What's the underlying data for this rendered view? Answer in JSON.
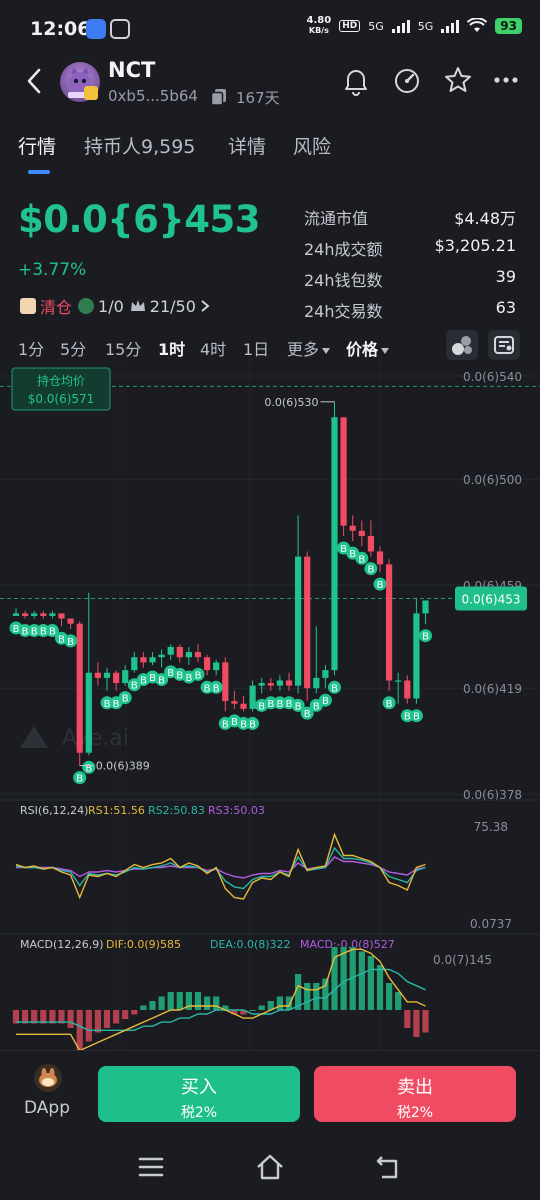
{
  "status_bar": {
    "time": "12:06",
    "net_speed_value": "4.80",
    "net_speed_unit": "KB/s",
    "hd_label": "HD",
    "signal_1": "5G",
    "signal_2": "5G",
    "battery": "93"
  },
  "header": {
    "token_name": "NCT",
    "address": "0xb5...5b64",
    "age": "167天"
  },
  "tabs": [
    {
      "label": "行情"
    },
    {
      "label": "持币人9,595"
    },
    {
      "label": "详情"
    },
    {
      "label": "风险"
    }
  ],
  "price": {
    "value": "$0.0{6}453",
    "change": "+3.77%"
  },
  "tags": {
    "clear": "清仓",
    "ratio": "1/0",
    "rank": "21/50"
  },
  "stats": [
    {
      "label": "流通市值",
      "value": "$4.48万"
    },
    {
      "label": "24h成交额",
      "value": "$3,205.21"
    },
    {
      "label": "24h钱包数",
      "value": "39"
    },
    {
      "label": "24h交易数",
      "value": "63"
    }
  ],
  "intervals": [
    {
      "label": "1分"
    },
    {
      "label": "5分"
    },
    {
      "label": "15分"
    },
    {
      "label": "1时"
    },
    {
      "label": "4时"
    },
    {
      "label": "1日"
    },
    {
      "label": "更多"
    },
    {
      "label": "价格"
    }
  ],
  "colors": {
    "up": "#20c38e",
    "down": "#ef4b62",
    "accent": "#3d8bfd",
    "rsi1": "#e7b93a",
    "rsi2": "#28b6a8",
    "rsi3": "#b35be0"
  },
  "chart_data": {
    "type": "candlestick",
    "watermark": "Ave.ai",
    "position_avg_label": "持仓均价",
    "position_avg_value": "$0.0(6)571",
    "current_price_tag": "0.0(6)453",
    "y_axis_ticks": [
      "0.0(6)540",
      "0.0(6)500",
      "0.0(6)459",
      "0.0(6)419",
      "0.0(6)378"
    ],
    "y_axis_values": [
      540,
      500,
      459,
      419,
      378
    ],
    "high_label": "0.0(6)530",
    "low_label": "0.0(6)389",
    "trade_marker_label": "B",
    "candles": [
      [
        447,
        450,
        447,
        448
      ],
      [
        448,
        449,
        446,
        447
      ],
      [
        447,
        449,
        446,
        448
      ],
      [
        448,
        449,
        446,
        447
      ],
      [
        447,
        449,
        446,
        448
      ],
      [
        448,
        448,
        443,
        446
      ],
      [
        446,
        446,
        442,
        444
      ],
      [
        444,
        445,
        389,
        394
      ],
      [
        394,
        456,
        393,
        425
      ],
      [
        425,
        429,
        420,
        423
      ],
      [
        423,
        427,
        418,
        425
      ],
      [
        425,
        426,
        418,
        421
      ],
      [
        421,
        428,
        420,
        426
      ],
      [
        426,
        433,
        425,
        431
      ],
      [
        431,
        433,
        427,
        429
      ],
      [
        429,
        433,
        428,
        431
      ],
      [
        431,
        434,
        427,
        432
      ],
      [
        432,
        436,
        430,
        435
      ],
      [
        435,
        436,
        429,
        431
      ],
      [
        431,
        435,
        428,
        433
      ],
      [
        433,
        436,
        429,
        431
      ],
      [
        431,
        432,
        424,
        426
      ],
      [
        426,
        430,
        424,
        429
      ],
      [
        429,
        431,
        410,
        414
      ],
      [
        414,
        418,
        411,
        413
      ],
      [
        413,
        416,
        410,
        411
      ],
      [
        411,
        422,
        410,
        420
      ],
      [
        420,
        423,
        417,
        421
      ],
      [
        421,
        423,
        418,
        420
      ],
      [
        420,
        424,
        418,
        422
      ],
      [
        422,
        425,
        418,
        420
      ],
      [
        420,
        486,
        417,
        470
      ],
      [
        470,
        472,
        414,
        419
      ],
      [
        419,
        443,
        417,
        423
      ],
      [
        423,
        428,
        419,
        426
      ],
      [
        426,
        530,
        424,
        524
      ],
      [
        524,
        524,
        478,
        482
      ],
      [
        482,
        486,
        476,
        480
      ],
      [
        480,
        484,
        474,
        478
      ],
      [
        478,
        484,
        470,
        472
      ],
      [
        472,
        474,
        464,
        467
      ],
      [
        467,
        469,
        418,
        422
      ],
      [
        422,
        425,
        413,
        422
      ],
      [
        422,
        424,
        413,
        415
      ],
      [
        415,
        454,
        413,
        448
      ],
      [
        448,
        453,
        444,
        453
      ]
    ],
    "buy_markers": [
      0,
      1,
      2,
      3,
      4,
      5,
      6,
      7,
      8,
      10,
      11,
      12,
      13,
      14,
      15,
      16,
      17,
      18,
      19,
      20,
      21,
      22,
      23,
      24,
      25,
      26,
      27,
      28,
      29,
      30,
      31,
      32,
      33,
      34,
      35,
      36,
      37,
      38,
      39,
      40,
      41,
      43,
      44,
      45
    ],
    "rsi": {
      "label": "RSI(6,12,24)",
      "rs1": "RS1:51.56",
      "rs2": "RS2:50.83",
      "rs3": "RS3:50.03",
      "axis_top": "75.38",
      "axis_bottom": "0.0737",
      "rsi6": [
        52,
        50,
        51,
        49,
        50,
        47,
        45,
        30,
        45,
        44,
        46,
        44,
        48,
        52,
        50,
        52,
        53,
        56,
        50,
        53,
        51,
        46,
        50,
        36,
        30,
        29,
        40,
        43,
        42,
        47,
        44,
        62,
        48,
        50,
        51,
        72,
        58,
        58,
        56,
        54,
        50,
        40,
        38,
        35,
        50,
        52
      ],
      "rsi12": [
        51,
        50,
        50,
        49,
        50,
        48,
        47,
        38,
        46,
        45,
        46,
        45,
        47,
        50,
        49,
        50,
        51,
        53,
        50,
        51,
        50,
        47,
        49,
        41,
        37,
        36,
        42,
        44,
        44,
        47,
        45,
        57,
        48,
        49,
        50,
        63,
        56,
        56,
        55,
        53,
        50,
        44,
        42,
        40,
        48,
        50
      ],
      "rsi24": [
        50,
        50,
        50,
        50,
        50,
        49,
        48,
        44,
        47,
        47,
        48,
        47,
        48,
        49,
        49,
        50,
        50,
        51,
        50,
        50,
        50,
        48,
        49,
        46,
        44,
        43,
        45,
        46,
        46,
        48,
        47,
        53,
        49,
        50,
        50,
        57,
        54,
        54,
        53,
        52,
        50,
        47,
        46,
        45,
        49,
        50
      ]
    },
    "macd": {
      "label": "MACD(12,26,9)",
      "dif_label": "DIF:0.0(9)585",
      "dea_label": "DEA:0.0(8)322",
      "macd_label": "MACD:-0.0(8)527",
      "axis_top": "0.0(7)145",
      "hist": [
        -3,
        -3,
        -3,
        -3,
        -3,
        -3,
        -4,
        -12,
        -7,
        -5,
        -4,
        -3,
        -2,
        -1,
        1,
        2,
        3,
        4,
        4,
        4,
        4,
        3,
        3,
        1,
        -1,
        -1,
        0,
        1,
        2,
        3,
        3,
        8,
        6,
        6,
        7,
        14,
        14,
        14,
        13,
        12,
        10,
        6,
        4,
        -4,
        -6,
        -5
      ],
      "dif": [
        -6,
        -6,
        -6,
        -6,
        -6,
        -6,
        -6,
        -10,
        -9,
        -8,
        -7,
        -6,
        -5,
        -4,
        -3,
        -2,
        -1,
        0,
        0,
        1,
        1,
        1,
        1,
        0,
        -1,
        -2,
        -2,
        -1,
        0,
        1,
        1,
        6,
        5,
        5,
        6,
        13,
        14,
        15,
        15,
        14,
        12,
        8,
        5,
        2,
        2,
        1
      ],
      "dea": [
        -3,
        -3,
        -3,
        -3,
        -3,
        -3,
        -3,
        -4,
        -5,
        -5,
        -5,
        -5,
        -5,
        -5,
        -4,
        -4,
        -3,
        -3,
        -2,
        -2,
        -1,
        -1,
        0,
        0,
        0,
        0,
        -1,
        -1,
        -1,
        0,
        0,
        1,
        2,
        3,
        3,
        5,
        7,
        8,
        9,
        10,
        10,
        10,
        9,
        7,
        6,
        5
      ]
    }
  },
  "bottom": {
    "dapp_label": "DApp",
    "buy_label": "买入",
    "buy_tax": "税2%",
    "sell_label": "卖出",
    "sell_tax": "税2%"
  }
}
